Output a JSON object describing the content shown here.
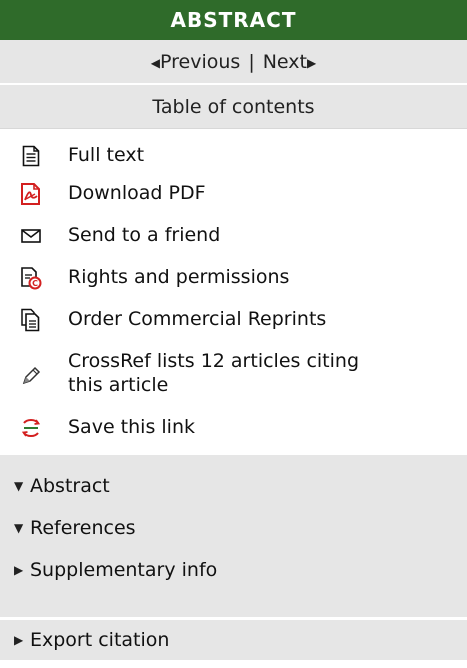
{
  "header": {
    "title": "ABSTRACT"
  },
  "nav": {
    "previous_label": "Previous",
    "separator": "|",
    "next_label": "Next"
  },
  "toc": {
    "label": "Table of contents"
  },
  "links": {
    "items": [
      {
        "label": "Full text",
        "icon": "document-icon"
      },
      {
        "label": "Download PDF",
        "icon": "pdf-icon"
      },
      {
        "label": "Send to a friend",
        "icon": "envelope-icon"
      },
      {
        "label": "Rights and permissions",
        "icon": "rights-icon"
      },
      {
        "label": "Order Commercial Reprints",
        "icon": "reprints-icon"
      },
      {
        "label_line1": "CrossRef lists 12 articles citing",
        "label_line2": "this article",
        "icon": "pen-icon"
      },
      {
        "label": "Save this link",
        "icon": "save-link-icon"
      }
    ]
  },
  "sections": {
    "items": [
      {
        "label": "Abstract",
        "state": "expanded"
      },
      {
        "label": "References",
        "state": "expanded"
      },
      {
        "label": "Supplementary info",
        "state": "collapsed"
      }
    ]
  },
  "export": {
    "label": "Export citation",
    "state": "collapsed"
  },
  "colors": {
    "header_bg": "#2f6b2a",
    "panel_gray": "#e6e6e6",
    "pdf_red": "#d32020"
  }
}
